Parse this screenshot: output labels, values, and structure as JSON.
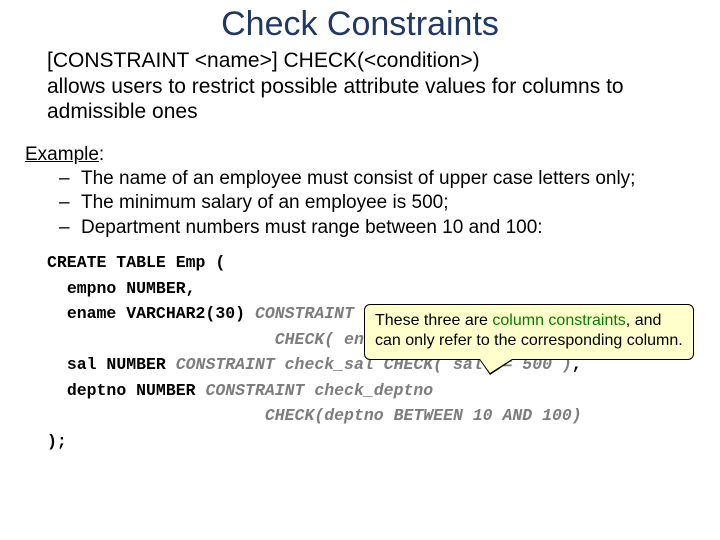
{
  "title": "Check Constraints",
  "intro_line1": "[CONSTRAINT <name>] CHECK(<condition>)",
  "intro_line2": "allows users to restrict possible attribute values for columns to admissible ones",
  "example_label": "Example",
  "example_colon": ":",
  "bullets": [
    "The name of an employee must consist of upper case letters only;",
    "The minimum salary of an employee is 500;",
    "Department numbers must range between 10 and 100:"
  ],
  "code": {
    "l1": "CREATE TABLE Emp (",
    "l2a": "empno NUMBER,",
    "l3a": "ename VARCHAR2(30) ",
    "l3b": "CONSTRAINT check_name",
    "l4b": "CHECK( ename = UPPER(ename) ),",
    "l5a": "sal NUMBER ",
    "l5b": "CONSTRAINT check_sal CHECK( sal >= 500 )",
    "l5c": ",",
    "l6a": "deptno NUMBER ",
    "l6b": "CONSTRAINT check_deptno",
    "l7b": "CHECK(deptno BETWEEN 10 AND 100)",
    "l8": ");"
  },
  "callout_pre": "These three are ",
  "callout_green": "column constraints",
  "callout_post": ", and can only refer to the corresponding column."
}
